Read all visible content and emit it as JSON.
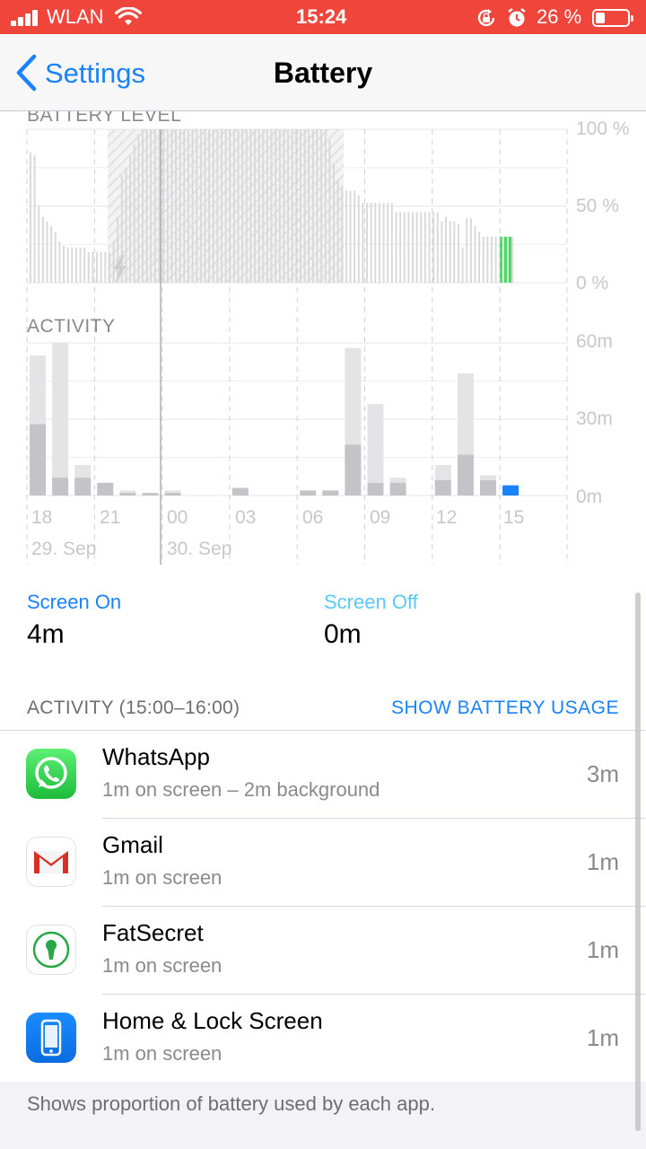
{
  "status_bar": {
    "carrier": "WLAN",
    "time": "15:24",
    "battery_percent": "26 %",
    "battery_level": 0.26,
    "icons": [
      "signal-icon",
      "wifi-icon",
      "orientation-lock-icon",
      "alarm-icon",
      "battery-icon"
    ]
  },
  "nav": {
    "back_label": "Settings",
    "title": "Battery"
  },
  "battery_chart": {
    "label": "BATTERY LEVEL",
    "y_labels": [
      "100 %",
      "50 %",
      "0 %"
    ]
  },
  "activity_chart": {
    "label": "ACTIVITY",
    "y_labels": [
      "60m",
      "30m",
      "0m"
    ],
    "x_ticks": [
      "18",
      "21",
      "00",
      "03",
      "06",
      "09",
      "12",
      "15"
    ],
    "date_labels": [
      "29. Sep",
      "30. Sep"
    ]
  },
  "chart_data": [
    {
      "type": "bar",
      "title": "BATTERY LEVEL",
      "ylabel": "",
      "ylim": [
        0,
        100
      ],
      "y_ticks": [
        "100 %",
        "50 %",
        "0 %"
      ],
      "x_ticks": [
        "18",
        "21",
        "00",
        "03",
        "06",
        "09",
        "12",
        "15"
      ],
      "values": [
        85,
        83,
        50,
        43,
        40,
        37,
        33,
        27,
        24,
        23,
        23,
        23,
        23,
        23,
        20,
        20,
        20,
        20,
        20,
        20,
        27,
        43,
        70,
        75,
        83,
        90,
        97,
        100,
        100,
        100,
        100,
        100,
        100,
        100,
        100,
        100,
        100,
        100,
        100,
        100,
        100,
        100,
        100,
        100,
        100,
        100,
        100,
        100,
        100,
        100,
        100,
        100,
        100,
        100,
        100,
        100,
        100,
        100,
        100,
        100,
        100,
        100,
        100,
        100,
        100,
        100,
        100,
        100,
        100,
        100,
        100,
        100,
        93,
        78,
        67,
        62,
        60,
        60,
        60,
        57,
        52,
        52,
        52,
        52,
        52,
        52,
        52,
        52,
        46,
        46,
        46,
        46,
        46,
        46,
        46,
        46,
        46,
        46,
        46,
        40,
        43,
        40,
        40,
        38,
        23,
        42,
        42,
        37,
        33,
        30,
        30,
        30,
        30,
        30,
        30,
        30,
        30
      ],
      "charging_hours": "21–09",
      "current_level_bars": [
        30,
        30,
        30
      ]
    },
    {
      "type": "bar",
      "title": "ACTIVITY",
      "ylabel": "",
      "ylim": [
        0,
        60
      ],
      "y_ticks": [
        "60m",
        "30m",
        "0m"
      ],
      "categories": [
        "18",
        "19",
        "20",
        "21",
        "22",
        "23",
        "00",
        "01",
        "02",
        "03",
        "04",
        "05",
        "06",
        "07",
        "08",
        "09",
        "10",
        "11",
        "12",
        "13",
        "14",
        "15"
      ],
      "series": [
        {
          "values": [
            28,
            7,
            7,
            5,
            1,
            1,
            1,
            0,
            0,
            3,
            0,
            0,
            2,
            2,
            20,
            5,
            5,
            0,
            6,
            16,
            6,
            0
          ]
        },
        {
          "values": [
            55,
            60,
            12,
            5,
            2,
            1,
            2,
            0,
            0,
            3,
            0,
            0,
            2,
            2,
            58,
            36,
            7,
            0,
            12,
            48,
            8,
            4
          ]
        }
      ],
      "highlight_category": "15"
    }
  ],
  "screen_stats": {
    "on_label": "Screen On",
    "on_value": "4m",
    "off_label": "Screen Off",
    "off_value": "0m",
    "on_color": "#1a82fb",
    "off_color": "#5ac8fa"
  },
  "activity_list": {
    "header": "ACTIVITY (15:00–16:00)",
    "show_usage": "SHOW BATTERY USAGE",
    "apps": [
      {
        "name": "WhatsApp",
        "detail": "1m on screen – 2m background",
        "time": "3m",
        "icon": "whatsapp-icon"
      },
      {
        "name": "Gmail",
        "detail": "1m on screen",
        "time": "1m",
        "icon": "gmail-icon"
      },
      {
        "name": "FatSecret",
        "detail": "1m on screen",
        "time": "1m",
        "icon": "fatsecret-icon"
      },
      {
        "name": "Home & Lock Screen",
        "detail": "1m on screen",
        "time": "1m",
        "icon": "home-lock-screen-icon"
      }
    ]
  },
  "footer": {
    "text": "Shows proportion of battery used by each app."
  },
  "colors": {
    "status_bar": "#f0453a",
    "accent": "#1a82fb",
    "charging": "#4cd964"
  }
}
